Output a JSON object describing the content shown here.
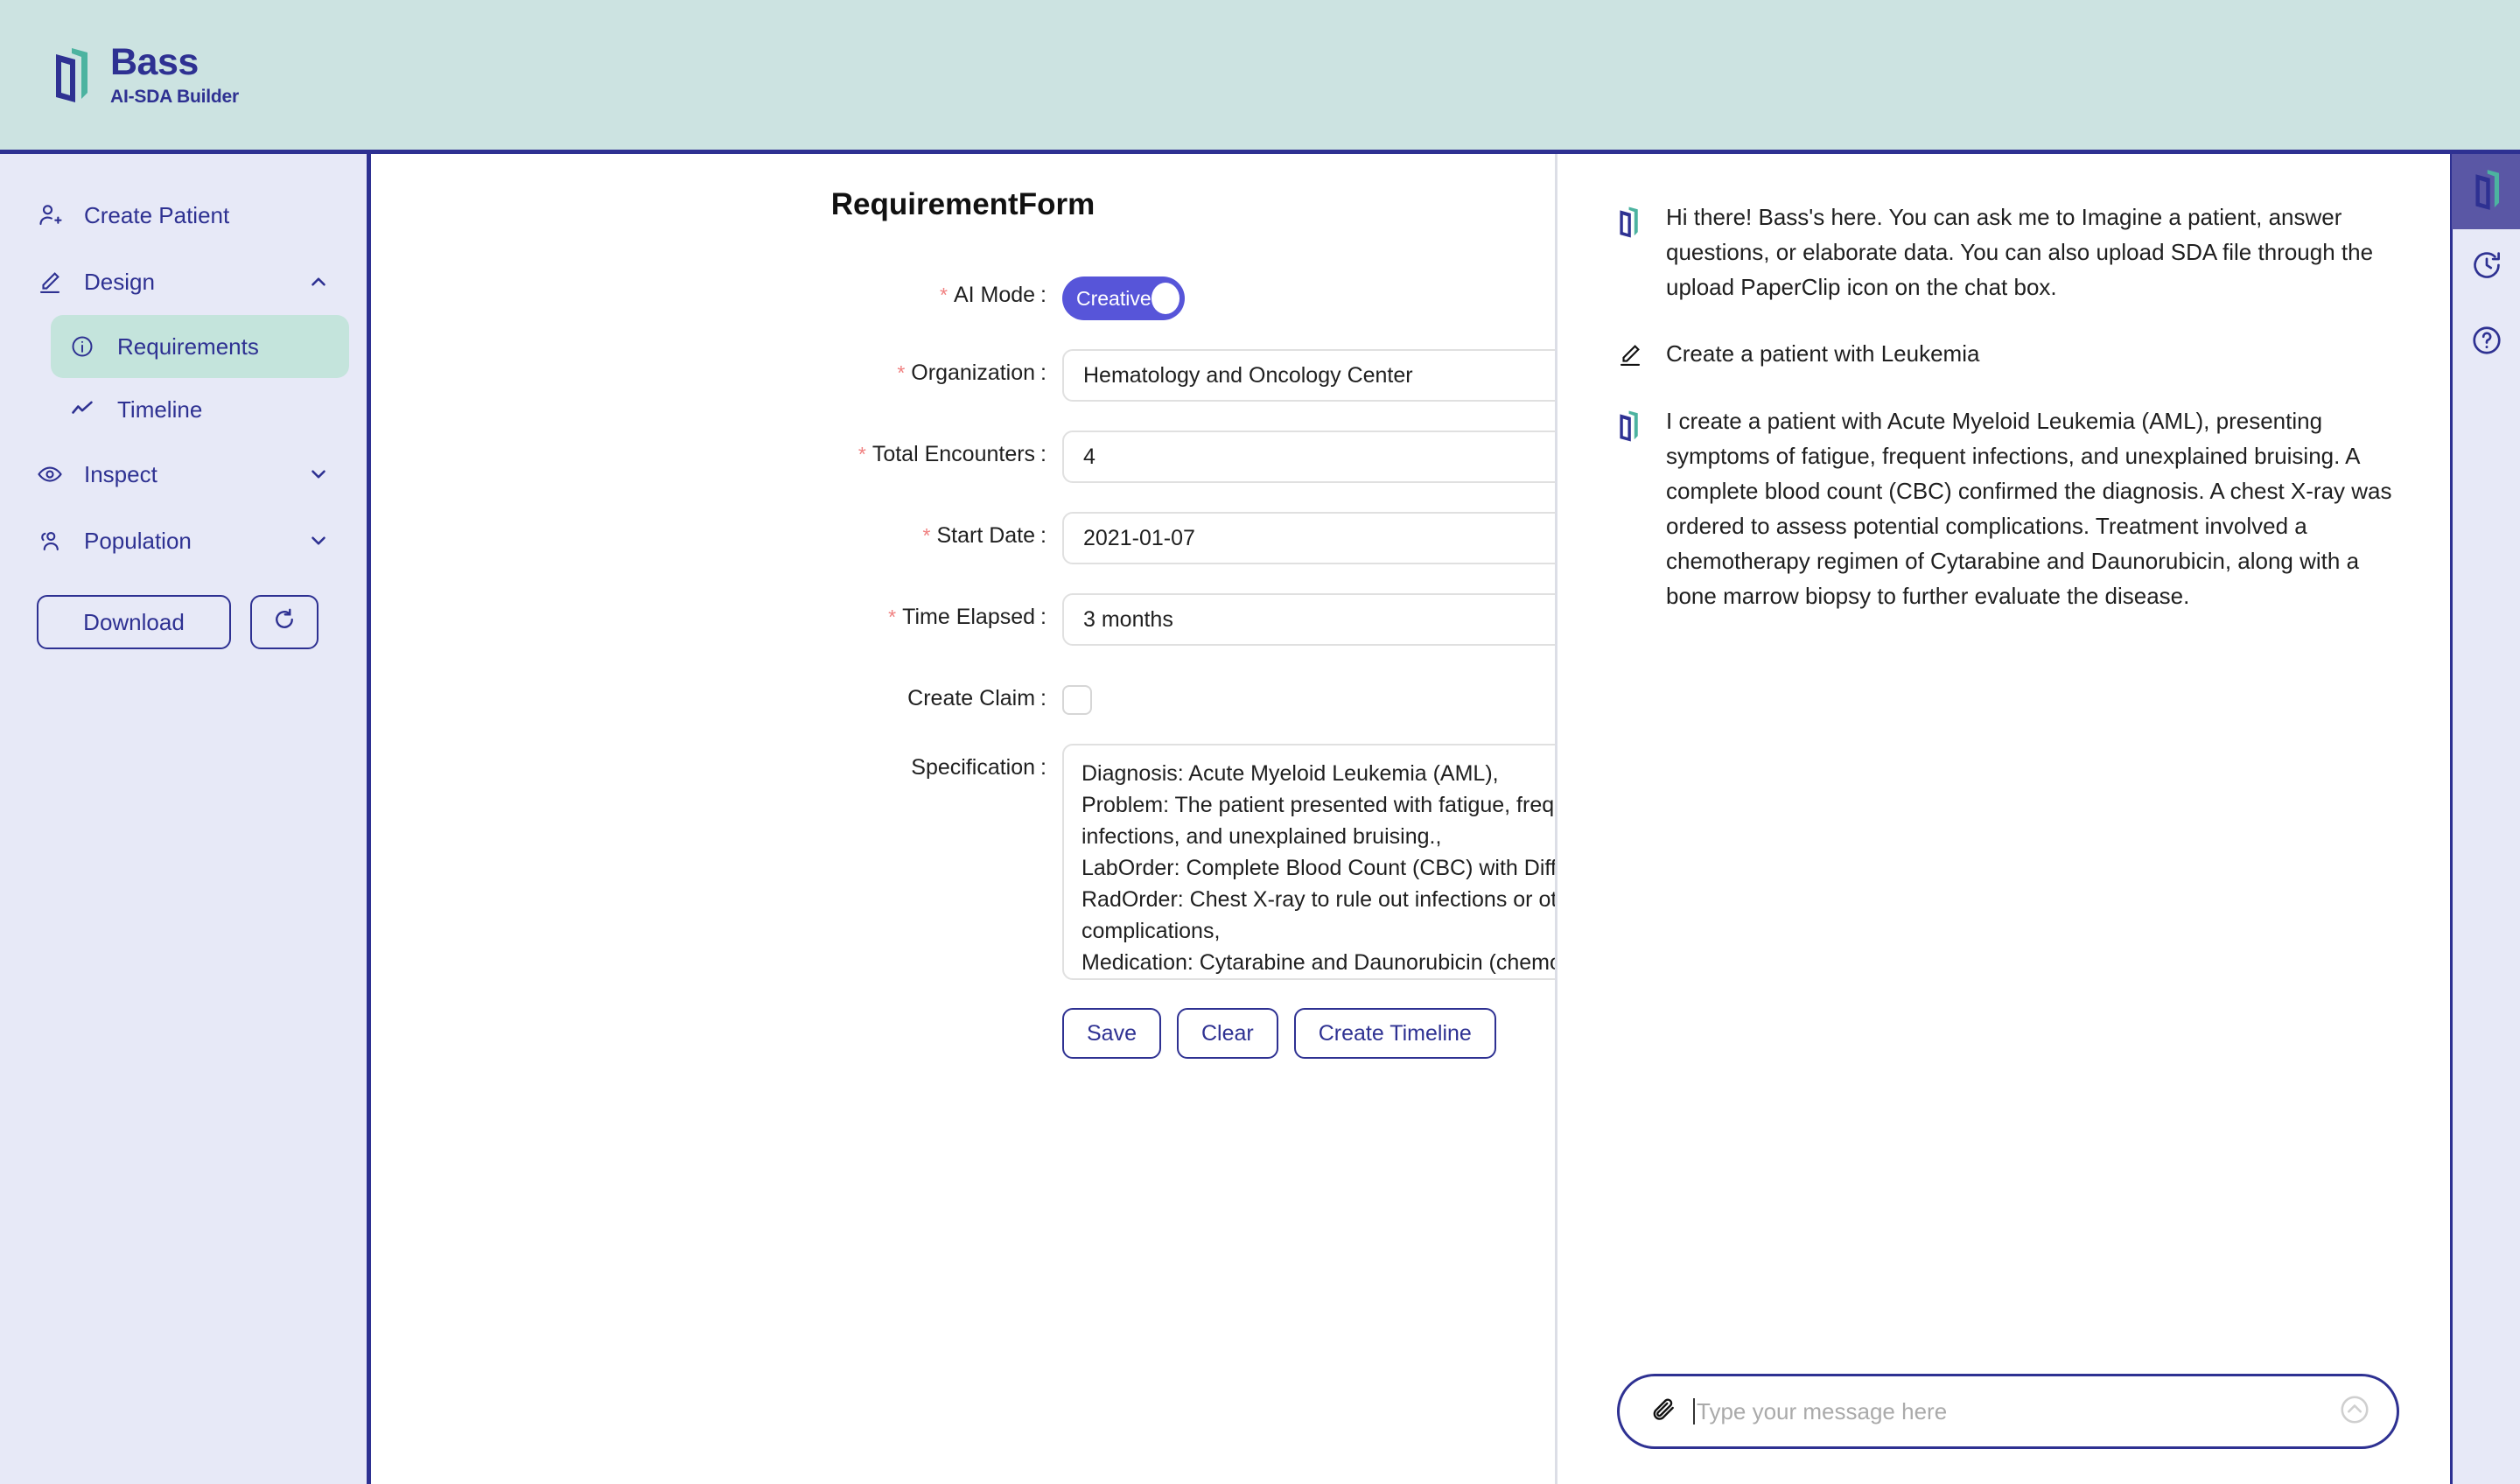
{
  "header": {
    "brand_name": "Bass",
    "brand_sub": "AI-SDA Builder",
    "logo_icon": "bass-bracket-logo"
  },
  "sidebar": {
    "items": [
      {
        "label": "Create Patient",
        "icon": "user-plus-icon"
      },
      {
        "label": "Design",
        "icon": "pencil-icon",
        "chevron": "chevron-up-icon"
      },
      {
        "label": "Requirements",
        "icon": "info-circle-icon"
      },
      {
        "label": "Timeline",
        "icon": "line-chart-icon"
      },
      {
        "label": "Inspect",
        "icon": "eye-icon",
        "chevron": "chevron-down-icon"
      },
      {
        "label": "Population",
        "icon": "users-icon",
        "chevron": "chevron-down-icon"
      }
    ],
    "download_label": "Download",
    "refresh_icon": "refresh-icon"
  },
  "form": {
    "title": "RequirementForm",
    "fields": {
      "ai_mode_label": "AI Mode",
      "ai_mode_value": "Creative",
      "organization_label": "Organization",
      "organization_value": "Hematology and Oncology Center",
      "total_encounters_label": "Total Encounters",
      "total_encounters_value": "4",
      "start_date_label": "Start Date",
      "start_date_value": "2021-01-07",
      "start_date_icon": "calendar-icon",
      "time_elapsed_label": "Time Elapsed",
      "time_elapsed_value": "3 months",
      "create_claim_label": "Create Claim",
      "specification_label": "Specification",
      "specification_value": "Diagnosis: Acute Myeloid Leukemia (AML),\nProblem: The patient presented with fatigue, frequent infections, and unexplained bruising.,\nLabOrder: Complete Blood Count (CBC) with Differential,\nRadOrder: Chest X-ray to rule out infections or other complications,\nMedication: Cytarabine and Daunorubicin (chemotherapy"
    },
    "buttons": {
      "save": "Save",
      "clear": "Clear",
      "create_timeline": "Create Timeline"
    },
    "required_marker": "*",
    "colon": ":"
  },
  "chat": {
    "messages": [
      {
        "role": "assistant",
        "icon": "bass-bracket-logo",
        "text": "Hi there! Bass's here. You can ask me to Imagine a patient, answer questions, or elaborate data. You can also upload SDA file through the upload PaperClip icon on the chat box."
      },
      {
        "role": "user",
        "icon": "pencil-icon",
        "text": "Create a patient with Leukemia"
      },
      {
        "role": "assistant",
        "icon": "bass-bracket-logo",
        "text": "I create a patient with Acute Myeloid Leukemia (AML), presenting symptoms of fatigue, frequent infections, and unexplained bruising. A complete blood count (CBC) confirmed the diagnosis. A chest X-ray was ordered to assess potential complications. Treatment involved a chemotherapy regimen of Cytarabine and Daunorubicin, along with a bone marrow biopsy to further evaluate the disease."
      }
    ],
    "input_placeholder": "Type your message here",
    "attach_icon": "paperclip-icon",
    "send_icon": "send-circle-up-icon"
  },
  "rail": {
    "items": [
      {
        "icon": "bass-logo-icon",
        "active": true
      },
      {
        "icon": "history-clock-icon",
        "active": false
      },
      {
        "icon": "help-question-icon",
        "active": false
      }
    ]
  },
  "colors": {
    "header_bg": "#CCE3E1",
    "navy": "#2E3192",
    "sidebar_bg": "#E7E9F7",
    "active_nav": "#C4E4DC",
    "toggle_on": "#5755D9",
    "required_star": "#F08080",
    "teal_accent": "#4CB3A0"
  }
}
